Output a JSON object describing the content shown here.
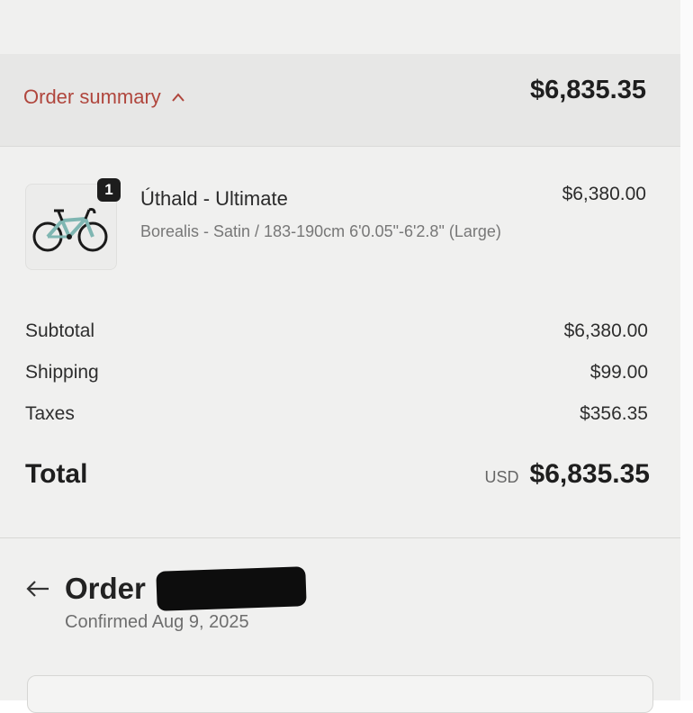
{
  "summary": {
    "toggle_label": "Order summary",
    "total": "$6,835.35"
  },
  "line_item": {
    "quantity": "1",
    "name": "Úthald - Ultimate",
    "variant": "Borealis - Satin / 183-190cm 6'0.05\"-6'2.8\" (Large)",
    "price": "$6,380.00",
    "image_icon": "road-bike-icon"
  },
  "costs": {
    "subtotal_label": "Subtotal",
    "subtotal_value": "$6,380.00",
    "shipping_label": "Shipping",
    "shipping_value": "$99.00",
    "taxes_label": "Taxes",
    "taxes_value": "$356.35",
    "total_label": "Total",
    "total_currency": "USD",
    "total_value": "$6,835.35"
  },
  "order": {
    "title": "Order",
    "confirmed": "Confirmed Aug 9, 2025"
  },
  "colors": {
    "accent": "#b0463d",
    "background": "#f0f0ef",
    "badge": "#1d1d1d"
  }
}
